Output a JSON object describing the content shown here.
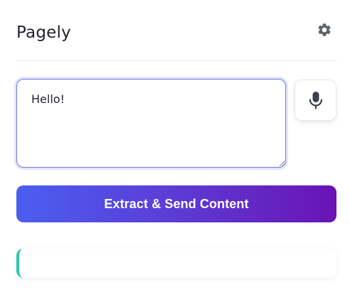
{
  "app": {
    "title": "Pagely"
  },
  "header": {
    "settings_icon": "gear-icon"
  },
  "composer": {
    "message_value": "Hello!",
    "mic_icon": "microphone-icon"
  },
  "actions": {
    "extract_label": "Extract & Send Content"
  },
  "status": {
    "text": ""
  },
  "colors": {
    "accent_start": "#4a5ef0",
    "accent_end": "#6a13b4",
    "status_accent": "#2bc8a6",
    "focus_border": "#6d7ae6"
  }
}
